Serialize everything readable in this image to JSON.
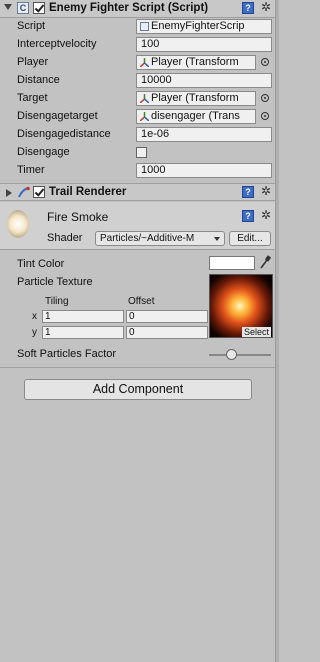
{
  "enemy_script": {
    "title": "Enemy Fighter Script (Script)",
    "fields": [
      {
        "label": "Script",
        "value": "EnemyFighterScrip"
      },
      {
        "label": "Interceptvelocity",
        "value": "100"
      },
      {
        "label": "Player",
        "value": "Player (Transform"
      },
      {
        "label": "Distance",
        "value": "10000"
      },
      {
        "label": "Target",
        "value": "Player (Transform"
      },
      {
        "label": "Disengagetarget",
        "value": "disengager (Trans"
      },
      {
        "label": "Disengagedistance",
        "value": "1e-06"
      },
      {
        "label": "Disengage",
        "value": ""
      },
      {
        "label": "Timer",
        "value": "1000"
      }
    ]
  },
  "trail_renderer": {
    "title": "Trail Renderer"
  },
  "material": {
    "name": "Fire Smoke",
    "shader_label": "Shader",
    "shader_value": "Particles/~Additive-M",
    "edit_label": "Edit...",
    "tint_label": "Tint Color",
    "texture_label": "Particle Texture",
    "tiling_label": "Tiling",
    "offset_label": "Offset",
    "x_label": "x",
    "y_label": "y",
    "tiling_x": "1",
    "tiling_y": "1",
    "offset_x": "0",
    "offset_y": "0",
    "select_label": "Select",
    "soft_label": "Soft Particles Factor"
  },
  "add_component_label": "Add Component",
  "icons": {
    "help": "?",
    "gear": "✲",
    "script": "C"
  }
}
